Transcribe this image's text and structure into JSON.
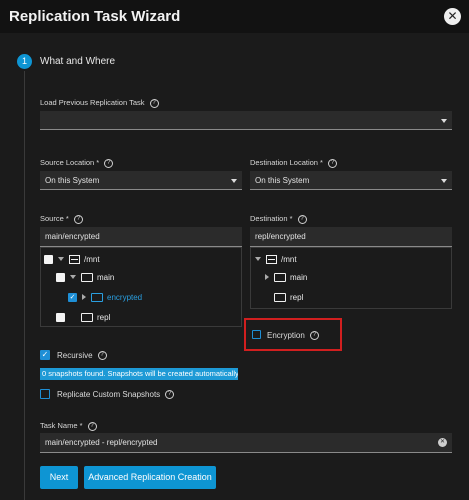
{
  "dialog": {
    "title": "Replication Task Wizard",
    "close_icon": "close-icon"
  },
  "step": {
    "number": "1",
    "label": "What and Where"
  },
  "load_previous": {
    "label": "Load Previous Replication Task",
    "value": ""
  },
  "source_location": {
    "label": "Source Location *",
    "value": "On this System"
  },
  "destination_location": {
    "label": "Destination Location *",
    "value": "On this System"
  },
  "source": {
    "label": "Source *",
    "value": "main/encrypted",
    "tree": [
      {
        "name": "/mnt",
        "checked": false
      },
      {
        "name": "main",
        "checked": false
      },
      {
        "name": "encrypted",
        "checked": true
      },
      {
        "name": "repl",
        "checked": false
      }
    ]
  },
  "destination": {
    "label": "Destination *",
    "value": "repl/encrypted",
    "tree": [
      {
        "name": "/mnt"
      },
      {
        "name": "main"
      },
      {
        "name": "repl"
      }
    ]
  },
  "encryption": {
    "label": "Encryption",
    "checked": false
  },
  "recursive": {
    "label": "Recursive",
    "checked": true
  },
  "snapshots_notice": "0 snapshots found. Snapshots will be created automatically.",
  "custom_snapshots": {
    "label": "Replicate Custom Snapshots",
    "checked": false
  },
  "task_name": {
    "label": "Task Name *",
    "value": "main/encrypted - repl/encrypted"
  },
  "buttons": {
    "next": "Next",
    "advanced": "Advanced Replication Creation"
  },
  "colors": {
    "accent": "#0e95d3",
    "highlight_border": "#d11f1f"
  }
}
